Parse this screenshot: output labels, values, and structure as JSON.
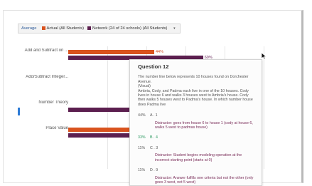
{
  "legend": {
    "average_label": "Average",
    "actual_label": "Actual (All Students)",
    "network_label": "Network (24 of 24 schools) (All Students)",
    "dropdown_icon": "chevron-down-icon"
  },
  "chart_data": {
    "type": "bar",
    "orientation": "horizontal",
    "categories": [
      "Add and Subtract on ...",
      "Add/Subtract Integer...",
      "Number Theory",
      "Place Value"
    ],
    "series": [
      {
        "name": "Actual (All Students)",
        "color": "#d9531e",
        "values": [
          44,
          null,
          null,
          67
        ],
        "value_labels": [
          "44%",
          "",
          "",
          "67%"
        ]
      },
      {
        "name": "Network (24 of 24 schools) (All Students)",
        "color": "#5c1f4f",
        "values": [
          69,
          null,
          72,
          67
        ],
        "value_labels": [
          "69%",
          "",
          "2%",
          "67%"
        ]
      }
    ],
    "xlim": [
      0,
      100
    ],
    "grid": true,
    "legend_position": "top-left"
  },
  "tooltip": {
    "title": "Question 12",
    "question_text": "The number line below represents 10 houses found on Dorchester Avenue.\n(Visual)\nAmbria, Cody, and Padma each live in one of the 10 houses. Cody lives in house 6 and walks 3 houses west to Ambria's house. Cody then walks 5 houses west to Padma's house. In which number house does Padma live",
    "answers": [
      {
        "pct": "44%",
        "letter": "A . 1",
        "correct": false,
        "distractor": "Distractor: goes from house 6 to house 1 (cody at house 6, walks 5 west to padmas house)"
      },
      {
        "pct": "33%",
        "letter": "B . 4",
        "correct": true,
        "distractor": ""
      },
      {
        "pct": "11%",
        "letter": "C . 3",
        "correct": false,
        "distractor": "Distractor: Student begins modeling operation at the incorrect starting point (starts at 0)"
      },
      {
        "pct": "11%",
        "letter": "D . 9",
        "correct": false,
        "distractor": "Distractor: Answer fulfills one criteria but not the other (only goes 3 west, not 5 west)"
      }
    ]
  },
  "colors": {
    "actual": "#d9531e",
    "network": "#5c1f4f",
    "correct_answer": "#2b9a61",
    "distractor_text": "#7a2d59"
  }
}
